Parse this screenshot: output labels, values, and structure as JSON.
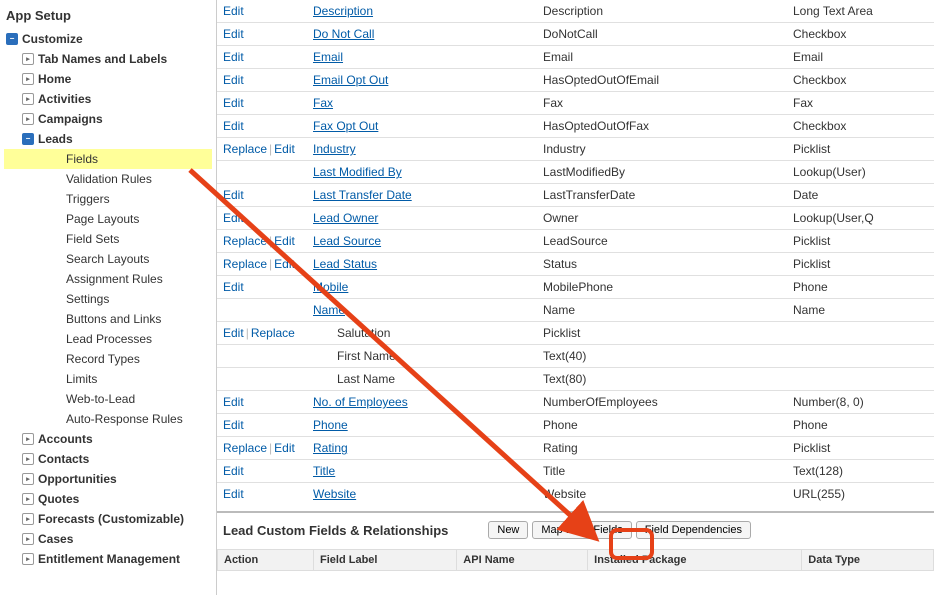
{
  "sidebar": {
    "title": "App Setup",
    "items": [
      {
        "label": "Customize",
        "level": 1,
        "icon": "minus"
      },
      {
        "label": "Tab Names and Labels",
        "level": 2,
        "icon": "plus"
      },
      {
        "label": "Home",
        "level": 2,
        "icon": "plus"
      },
      {
        "label": "Activities",
        "level": 2,
        "icon": "plus"
      },
      {
        "label": "Campaigns",
        "level": 2,
        "icon": "plus"
      },
      {
        "label": "Leads",
        "level": 2,
        "icon": "minus"
      },
      {
        "label": "Fields",
        "level": 3,
        "icon": "none",
        "active": true
      },
      {
        "label": "Validation Rules",
        "level": 3,
        "icon": "none"
      },
      {
        "label": "Triggers",
        "level": 3,
        "icon": "none"
      },
      {
        "label": "Page Layouts",
        "level": 3,
        "icon": "none"
      },
      {
        "label": "Field Sets",
        "level": 3,
        "icon": "none"
      },
      {
        "label": "Search Layouts",
        "level": 3,
        "icon": "none"
      },
      {
        "label": "Assignment Rules",
        "level": 3,
        "icon": "none"
      },
      {
        "label": "Settings",
        "level": 3,
        "icon": "none"
      },
      {
        "label": "Buttons and Links",
        "level": 3,
        "icon": "none"
      },
      {
        "label": "Lead Processes",
        "level": 3,
        "icon": "none"
      },
      {
        "label": "Record Types",
        "level": 3,
        "icon": "none"
      },
      {
        "label": "Limits",
        "level": 3,
        "icon": "none"
      },
      {
        "label": "Web-to-Lead",
        "level": 3,
        "icon": "none"
      },
      {
        "label": "Auto-Response Rules",
        "level": 3,
        "icon": "none"
      },
      {
        "label": "Accounts",
        "level": 2,
        "icon": "plus"
      },
      {
        "label": "Contacts",
        "level": 2,
        "icon": "plus"
      },
      {
        "label": "Opportunities",
        "level": 2,
        "icon": "plus"
      },
      {
        "label": "Quotes",
        "level": 2,
        "icon": "plus"
      },
      {
        "label": "Forecasts (Customizable)",
        "level": 2,
        "icon": "plus"
      },
      {
        "label": "Cases",
        "level": 2,
        "icon": "plus"
      },
      {
        "label": "Entitlement Management",
        "level": 2,
        "icon": "plus"
      }
    ]
  },
  "fields_table": [
    {
      "actions": [
        "Edit"
      ],
      "label": "Description",
      "api": "Description",
      "type": "Long Text Area"
    },
    {
      "actions": [
        "Edit"
      ],
      "label": "Do Not Call",
      "api": "DoNotCall",
      "type": "Checkbox"
    },
    {
      "actions": [
        "Edit"
      ],
      "label": "Email",
      "api": "Email",
      "type": "Email"
    },
    {
      "actions": [
        "Edit"
      ],
      "label": "Email Opt Out",
      "api": "HasOptedOutOfEmail",
      "type": "Checkbox"
    },
    {
      "actions": [
        "Edit"
      ],
      "label": "Fax",
      "api": "Fax",
      "type": "Fax"
    },
    {
      "actions": [
        "Edit"
      ],
      "label": "Fax Opt Out",
      "api": "HasOptedOutOfFax",
      "type": "Checkbox"
    },
    {
      "actions": [
        "Replace",
        "Edit"
      ],
      "label": "Industry",
      "api": "Industry",
      "type": "Picklist"
    },
    {
      "actions": [],
      "label": "Last Modified By",
      "api": "LastModifiedBy",
      "type": "Lookup(User)"
    },
    {
      "actions": [
        "Edit"
      ],
      "label": "Last Transfer Date",
      "api": "LastTransferDate",
      "type": "Date"
    },
    {
      "actions": [
        "Edit"
      ],
      "label": "Lead Owner",
      "api": "Owner",
      "type": "Lookup(User,Q"
    },
    {
      "actions": [
        "Replace",
        "Edit"
      ],
      "label": "Lead Source",
      "api": "LeadSource",
      "type": "Picklist"
    },
    {
      "actions": [
        "Replace",
        "Edit"
      ],
      "label": "Lead Status",
      "api": "Status",
      "type": "Picklist"
    },
    {
      "actions": [
        "Edit"
      ],
      "label": "Mobile",
      "api": "MobilePhone",
      "type": "Phone"
    },
    {
      "actions": [],
      "label": "Name",
      "api": "Name",
      "type": "Name"
    },
    {
      "actions": [
        "Edit",
        "Replace"
      ],
      "label": "Salutation",
      "api": "Picklist",
      "type": "",
      "indent": true,
      "nolink": true
    },
    {
      "actions": [],
      "label": "First Name",
      "api": "Text(40)",
      "type": "",
      "indent": true,
      "nolink": true
    },
    {
      "actions": [],
      "label": "Last Name",
      "api": "Text(80)",
      "type": "",
      "indent": true,
      "nolink": true
    },
    {
      "actions": [
        "Edit"
      ],
      "label": "No. of Employees",
      "api": "NumberOfEmployees",
      "type": "Number(8, 0)"
    },
    {
      "actions": [
        "Edit"
      ],
      "label": "Phone",
      "api": "Phone",
      "type": "Phone"
    },
    {
      "actions": [
        "Replace",
        "Edit"
      ],
      "label": "Rating",
      "api": "Rating",
      "type": "Picklist"
    },
    {
      "actions": [
        "Edit"
      ],
      "label": "Title",
      "api": "Title",
      "type": "Text(128)"
    },
    {
      "actions": [
        "Edit"
      ],
      "label": "Website",
      "api": "Website",
      "type": "URL(255)"
    }
  ],
  "custom_section": {
    "title": "Lead Custom Fields & Relationships",
    "buttons": [
      "New",
      "Map Lead Fields",
      "Field Dependencies"
    ],
    "columns": [
      "Action",
      "Field Label",
      "API Name",
      "Installed Package",
      "Data Type"
    ]
  }
}
